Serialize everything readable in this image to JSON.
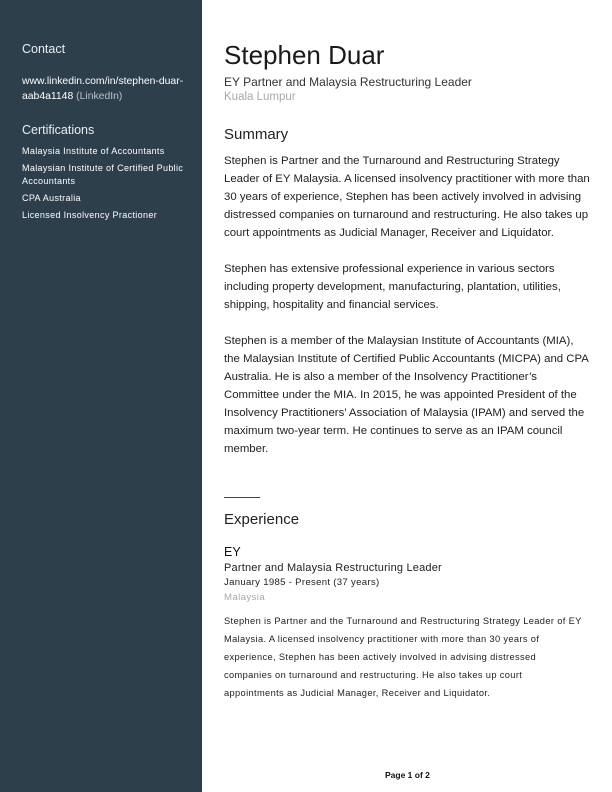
{
  "sidebar": {
    "contact_heading": "Contact",
    "linkedin_url": "www.linkedin.com/in/stephen-duar-aab4a1148",
    "linkedin_tag": "(LinkedIn)",
    "certifications_heading": "Certifications",
    "certifications": [
      "Malaysia Institute of Accountants",
      "Malaysian Institute of Certified Public Accountants",
      "CPA Australia",
      "Licensed Insolvency Practioner"
    ]
  },
  "profile": {
    "name": "Stephen Duar",
    "headline": "EY Partner and Malaysia Restructuring Leader",
    "location": "Kuala Lumpur"
  },
  "summary": {
    "heading": "Summary",
    "paragraphs": [
      "Stephen is Partner and the Turnaround and Restructuring Strategy Leader of EY Malaysia. A licensed insolvency practitioner with more than 30 years of experience, Stephen has been actively involved in advising distressed companies on turnaround and restructuring. He also takes up court appointments as Judicial Manager, Receiver and Liquidator.",
      "Stephen has extensive professional experience in various sectors including property development, manufacturing, plantation, utilities, shipping, hospitality and financial services.",
      "Stephen is a member of the Malaysian Institute of Accountants (MIA), the Malaysian Institute of Certified Public Accountants (MICPA) and CPA Australia. He is also a member of the Insolvency Practitioner’s Committee under the MIA. In 2015, he was appointed President of the Insolvency Practitioners’ Association of Malaysia (IPAM) and served the maximum two-year term. He continues to serve as an IPAM council member."
    ]
  },
  "experience": {
    "heading": "Experience",
    "items": [
      {
        "company": "EY",
        "role": "Partner and Malaysia Restructuring Leader",
        "dates": "January 1985 - Present (37 years)",
        "location": "Malaysia",
        "description": "Stephen is Partner and the Turnaround and Restructuring Strategy Leader of EY Malaysia. A licensed insolvency practitioner with more than 30 years of experience, Stephen has been actively involved in advising distressed companies on turnaround and restructuring. He also takes up court appointments as Judicial Manager, Receiver and Liquidator."
      }
    ]
  },
  "footer": {
    "page_label": "Page 1 of 2"
  }
}
